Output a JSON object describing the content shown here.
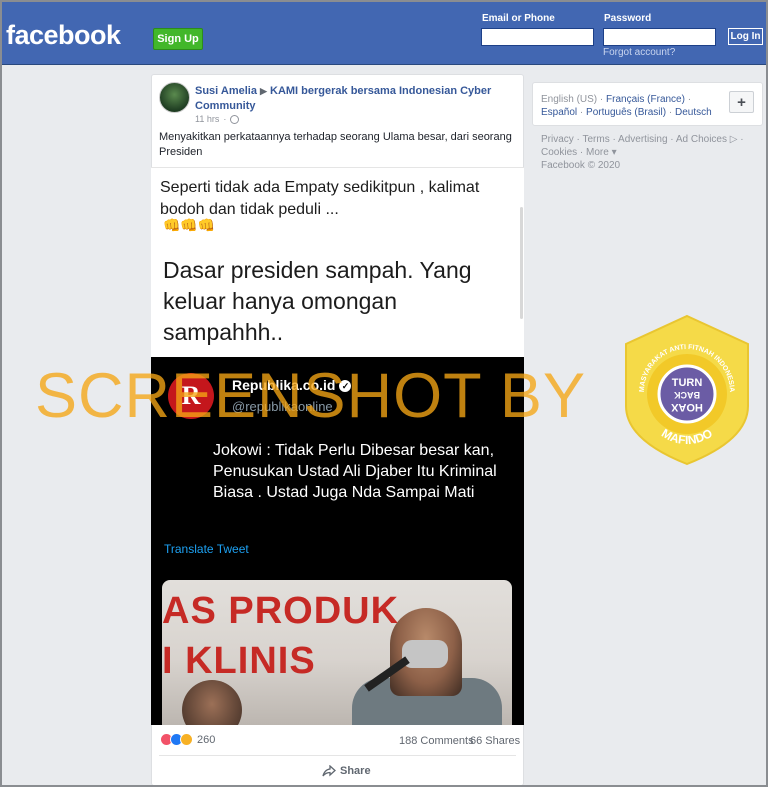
{
  "header": {
    "logo": "facebook",
    "signup_label": "Sign Up",
    "email_label": "Email or Phone",
    "password_label": "Password",
    "forgot_label": "Forgot account?",
    "login_label": "Log In"
  },
  "post": {
    "author": "Susi Amelia",
    "arrow": "▶",
    "group": "KAMI bergerak bersama Indonesian Cyber Community",
    "time": "11 hrs",
    "dot": "·",
    "caption": "Menyakitkan perkataannya terhadap seorang Ulama besar, dari seorang Presiden",
    "image_text_1": "Seperti tidak ada Empaty sedikitpun , kalimat bodoh dan tidak peduli ...",
    "image_fists": "👊👊👊",
    "image_text_2": "Dasar presiden sampah. Yang keluar hanya omongan sampahhh..",
    "tweet": {
      "logo_letter": "R",
      "account_name": "Republika.co.id",
      "handle": "@republikaonline",
      "text": "Jokowi : Tidak Perlu Dibesar besar kan, Penusukan Ustad Ali Djaber Itu Kriminal Biasa . Ustad Juga Nda Sampai Mati",
      "translate": "Translate Tweet",
      "photo_banner_1": "AS PRODUK",
      "photo_banner_2": "I KLINIS"
    },
    "reactions_count": "260",
    "comments": "188 Comments",
    "shares": "66 Shares",
    "share_label": "Share"
  },
  "watermark": {
    "text": "SCREENSHOT BY",
    "badge_top": "MASYARAKAT ANTI FITNAH INDONESIA",
    "badge_bottom": "MAFINDO",
    "badge_line1": "TURN",
    "badge_line2": "BACK",
    "badge_line3": "HOAX"
  },
  "sidebar": {
    "lang_current": "English (US)",
    "lang_2": "Français (France)",
    "lang_3": "Español",
    "lang_4": "Português (Brasil)",
    "lang_5": "Deutsch",
    "sep": "·",
    "plus": "+",
    "footer_line1": "Privacy · Terms · Advertising · Ad Choices ▷ ·",
    "footer_line2": "Cookies · More ▾",
    "footer_line3": "Facebook © 2020"
  },
  "colors": {
    "brand": "#4267b2",
    "signup": "#42b72a",
    "link": "#365899",
    "watermark": "#f5a514",
    "badge_yellow": "#f7d93a",
    "badge_purple": "#6b5ca5"
  }
}
